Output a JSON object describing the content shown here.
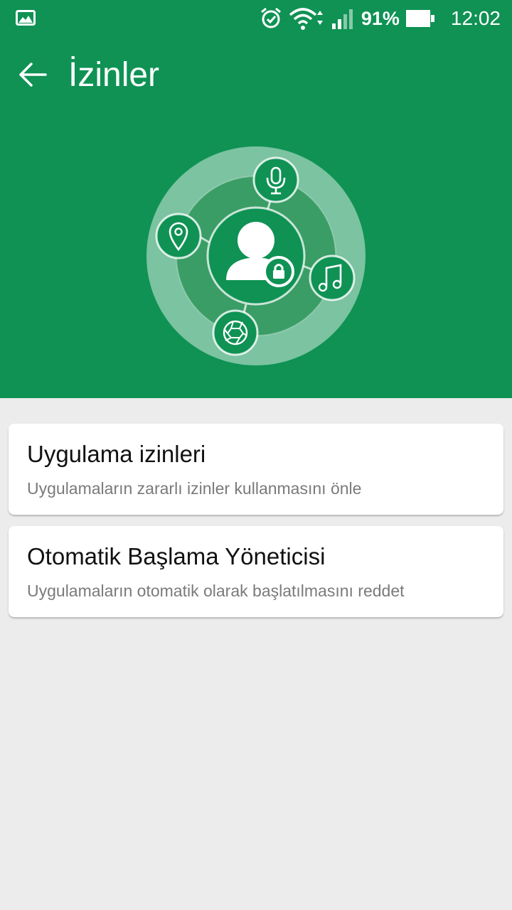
{
  "status_bar": {
    "battery_percent": "91%",
    "time": "12:02",
    "icons": [
      "gallery-icon",
      "alarm-icon",
      "wifi-icon",
      "signal-icon",
      "battery-icon"
    ]
  },
  "app_bar": {
    "title": "İzinler",
    "back_icon": "arrow-left-icon"
  },
  "hero": {
    "icons": [
      "microphone-icon",
      "location-icon",
      "user-lock-icon",
      "music-icon",
      "camera-aperture-icon"
    ]
  },
  "list": {
    "items": [
      {
        "title": "Uygulama izinleri",
        "subtitle": "Uygulamaların zararlı izinler kullanmasını önle"
      },
      {
        "title": "Otomatik Başlama Yöneticisi",
        "subtitle": "Uygulamaların otomatik olarak başlatılmasını reddet"
      }
    ]
  },
  "colors": {
    "primary": "#0f9254",
    "background": "#ececec",
    "card": "#ffffff",
    "title_text": "#111111",
    "subtitle_text": "#7a7a7a"
  }
}
